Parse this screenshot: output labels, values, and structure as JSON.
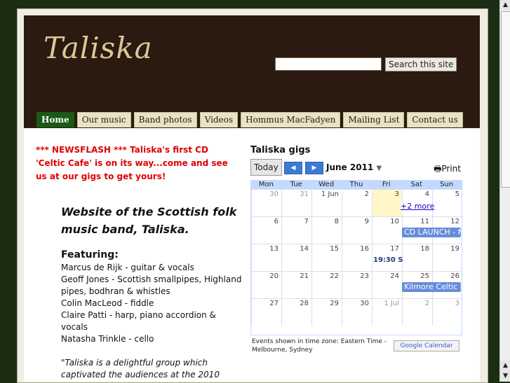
{
  "header": {
    "logo": "Taliska",
    "search_button": "Search this site",
    "search_placeholder": ""
  },
  "nav": {
    "tabs": [
      {
        "label": "Home"
      },
      {
        "label": "Our music"
      },
      {
        "label": "Band photos"
      },
      {
        "label": "Videos"
      },
      {
        "label": "Hommus MacFadyen"
      },
      {
        "label": "Mailing List"
      },
      {
        "label": "Contact us"
      }
    ]
  },
  "main": {
    "news": "*** NEWSFLASH *** Taliska's first CD 'Celtic Cafe' is on its way...come and see us at our gigs to get yours!",
    "tagline": "Website of the Scottish folk music band, Taliska.",
    "featuring_title": "Featuring:",
    "members": [
      "Marcus de Rijk - guitar & vocals",
      "Geoff Jones - Scottish smallpipes, Highland pipes, bodhran & whistles",
      "Colin MacLeod - fiddle",
      "Claire Patti - harp, piano accordion & vocals",
      "Natasha Trinkle - cello"
    ],
    "quote": "\"Taliska is a delightful group which captivated the audiences at the 2010"
  },
  "calendar": {
    "title": "Taliska gigs",
    "today_button": "Today",
    "month": "June 2011",
    "print": "Print",
    "days_of_week": [
      "Mon",
      "Tue",
      "Wed",
      "Thu",
      "Fri",
      "Sat",
      "Sun"
    ],
    "weeks": [
      [
        "30",
        "31",
        "1 Jun",
        "2",
        "3",
        "4",
        "5"
      ],
      [
        "6",
        "7",
        "8",
        "9",
        "10",
        "11",
        "12"
      ],
      [
        "13",
        "14",
        "15",
        "16",
        "17",
        "18",
        "19"
      ],
      [
        "20",
        "21",
        "22",
        "23",
        "24",
        "25",
        "26"
      ],
      [
        "27",
        "28",
        "29",
        "30",
        "1 Jul",
        "2",
        "3"
      ]
    ],
    "events": {
      "more": "+2 more",
      "cd_launch": "CD LAUNCH - N",
      "time_event": "19:30 S",
      "kilmore": "Kilmore Celtic F"
    },
    "timezone_note": "Events shown in time zone: Eastern Time - Melbourne, Sydney",
    "google_badge": "Google Calendar"
  }
}
